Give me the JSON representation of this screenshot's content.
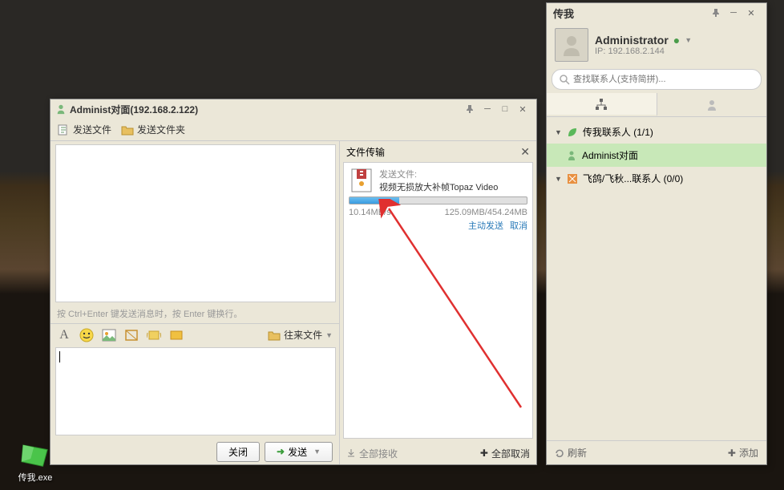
{
  "desktop": {
    "icon_label": "传我.exe"
  },
  "chat": {
    "title_user": "Administ对面",
    "title_ip": "(192.168.2.122)",
    "toolbar": {
      "send_file": "发送文件",
      "send_folder": "发送文件夹"
    },
    "hint": "按 Ctrl+Enter 键发送消息时，按 Enter 键换行。",
    "format": {
      "past_files": "往来文件"
    },
    "buttons": {
      "close": "关闭",
      "send": "发送"
    },
    "transfer": {
      "header": "文件传输",
      "send_label": "发送文件:",
      "filename": "视频无损放大补帧Topaz Video",
      "speed": "10.14MB/s",
      "progress": "125.09MB/454.24MB",
      "progress_pct": 28,
      "active_send": "主动发送",
      "cancel": "取消",
      "accept_all": "全部接收",
      "cancel_all": "全部取消"
    }
  },
  "contacts": {
    "app_title": "传我",
    "profile_name": "Administrator",
    "profile_ip": "IP: 192.168.2.144",
    "search_placeholder": "查找联系人(支持简拼)...",
    "groups": [
      {
        "name": "传我联系人 (1/1)",
        "icon": "green-leaf"
      },
      {
        "name": "飞鸽/飞秋...联系人 (0/0)",
        "icon": "orange-square"
      }
    ],
    "contacts_list": {
      "selected": "Administ对面"
    },
    "footer": {
      "refresh": "刷新",
      "add": "添加"
    }
  }
}
